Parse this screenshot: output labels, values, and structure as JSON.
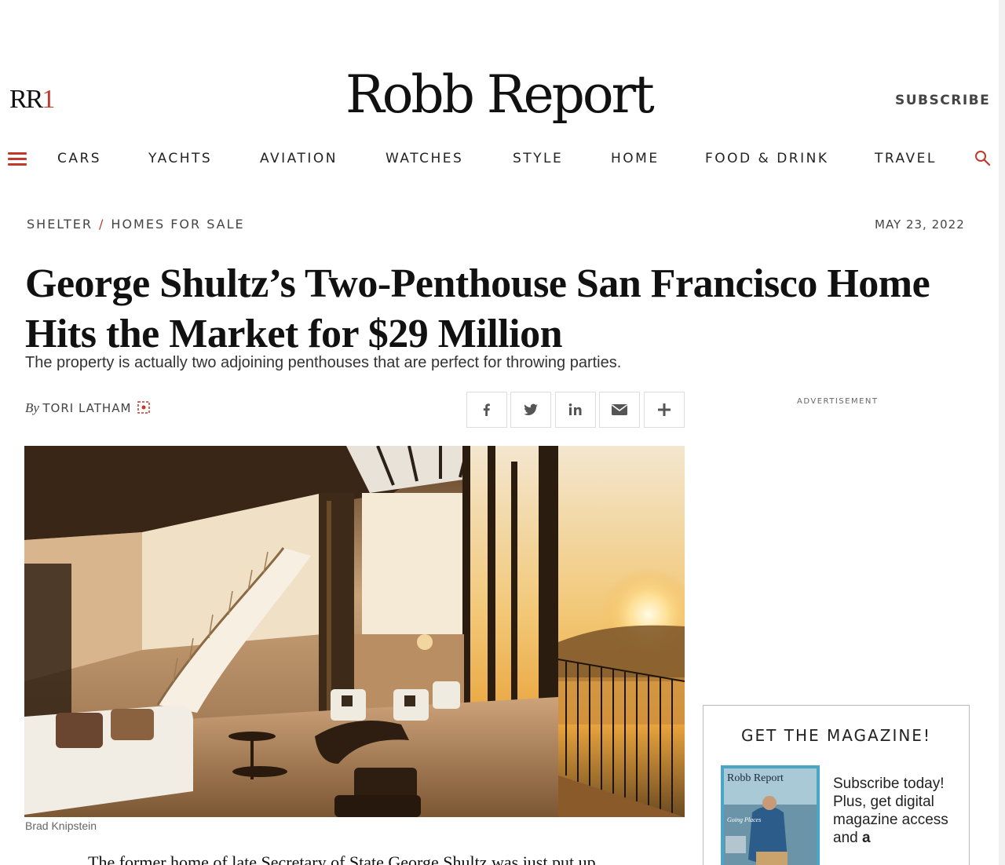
{
  "header": {
    "rr1": "RR",
    "rr1_accent": "1",
    "logo": "Robb Report",
    "subscribe": "SUBSCRIBE"
  },
  "nav": {
    "items": [
      "CARS",
      "YACHTS",
      "AVIATION",
      "WATCHES",
      "STYLE",
      "HOME",
      "FOOD & DRINK",
      "TRAVEL"
    ],
    "menu_icon": "hamburger-icon",
    "search_icon": "search-icon"
  },
  "breadcrumb": {
    "section": "SHELTER",
    "separator": "/",
    "subsection": "HOMES FOR SALE"
  },
  "date": "MAY 23, 2022",
  "article": {
    "headline": "George Shultz’s Two-Penthouse San Francisco Home Hits the Market for $29 Million",
    "dek": "The property is actually two adjoining penthouses that are perfect for throwing parties.",
    "by": "By",
    "author": "TORI LATHAM",
    "photo_credit": "Brad Knipstein",
    "body_start": "The former home of late Secretary of State George Shultz was just put up"
  },
  "share": {
    "icons": [
      "facebook-icon",
      "twitter-icon",
      "linkedin-icon",
      "email-icon",
      "plus-icon"
    ]
  },
  "ad_label": "ADVERTISEMENT",
  "magazine": {
    "title": "GET THE MAGAZINE!",
    "cover_title": "Robb Report",
    "cover_tagline": "Going Places",
    "text": "Subscribe today! Plus, get digital magazine access and",
    "text_bold": "a"
  },
  "colors": {
    "accent": "#c0392b",
    "text": "#111111",
    "muted": "#444444"
  }
}
